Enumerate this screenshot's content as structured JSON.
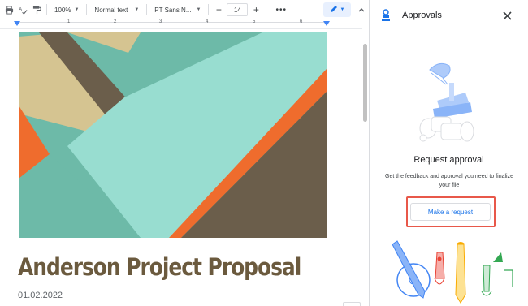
{
  "toolbar": {
    "zoom": "100%",
    "style": "Normal text",
    "font": "PT Sans N...",
    "font_size": "14",
    "minus": "−",
    "plus": "+",
    "more": "•••"
  },
  "ruler": {
    "numbers": [
      "1",
      "2",
      "3",
      "4",
      "5",
      "6"
    ]
  },
  "document": {
    "title": "Anderson Project Proposal",
    "date": "01.02.2022"
  },
  "panel": {
    "title": "Approvals",
    "heading": "Request approval",
    "description": "Get the feedback and approval you need to finalize your file",
    "button_label": "Make a request"
  },
  "colors": {
    "accent": "#1a73e8",
    "highlight": "#e8584a",
    "title_brown": "#6b5a3e",
    "mint": "#98ddd0",
    "teal": "#6dbaa8",
    "tan": "#d5c491",
    "orange": "#ef6c2d",
    "brown": "#6b5e4b"
  },
  "icons": [
    "print-icon",
    "spellcheck-icon",
    "paint-format-icon",
    "pencil-icon",
    "collapse-icon",
    "approvals-icon",
    "close-icon"
  ]
}
